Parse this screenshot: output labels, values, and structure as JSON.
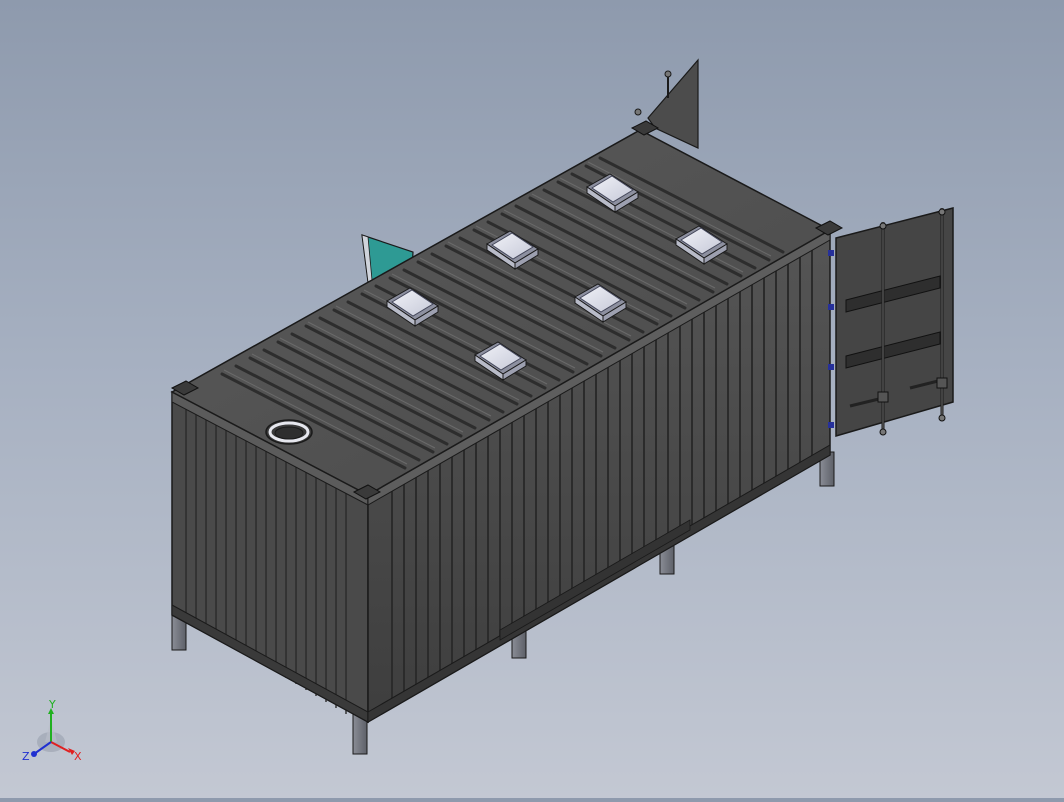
{
  "viewport": {
    "background_top": "#8e9aad",
    "background_bottom": "#c3c8d3"
  },
  "model": {
    "container_color": "#4a4a4a",
    "edge_color": "#1a1a1a",
    "vent_color": "#d9dbe6",
    "accent_panel_color": "#2e9a94",
    "roof_vent_count": 6,
    "door_state": "open"
  },
  "triad": {
    "x_label": "X",
    "y_label": "Y",
    "z_label": "Z",
    "x_color": "#e02020",
    "y_color": "#20b020",
    "z_color": "#2030d0"
  }
}
